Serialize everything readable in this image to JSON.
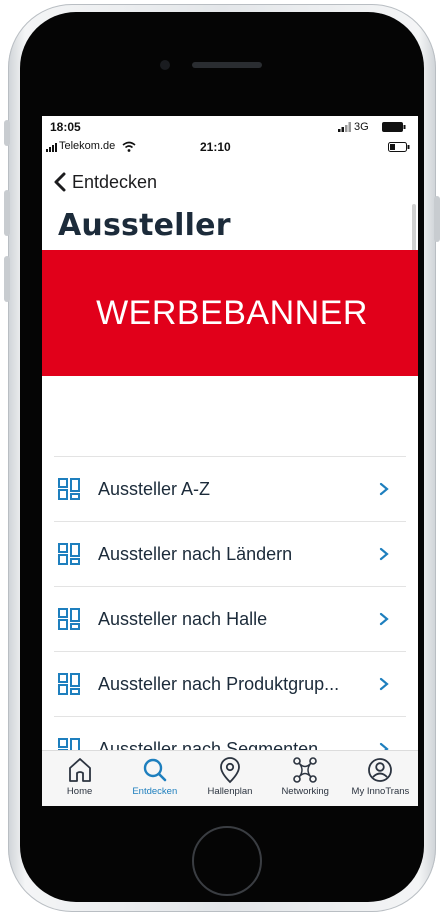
{
  "status": {
    "time_top": "18:05",
    "network_top": "3G",
    "carrier": "Telekom.de",
    "time_center": "21:10"
  },
  "nav": {
    "back_label": "Entdecken"
  },
  "page": {
    "title": "Aussteller"
  },
  "banner": {
    "text": "WERBEBANNER",
    "color": "#e1001a"
  },
  "list": {
    "items": [
      {
        "label": "Aussteller A-Z"
      },
      {
        "label": "Aussteller nach Ländern"
      },
      {
        "label": "Aussteller nach Halle"
      },
      {
        "label": "Aussteller nach Produktgrup..."
      },
      {
        "label": "Aussteller nach Segmenten"
      }
    ],
    "icon": "grid-icon",
    "accent": "#1e7fbe"
  },
  "tabbar": {
    "tabs": [
      {
        "label": "Home",
        "icon": "home-icon"
      },
      {
        "label": "Entdecken",
        "icon": "search-icon",
        "active": true
      },
      {
        "label": "Hallenplan",
        "icon": "location-pin-icon"
      },
      {
        "label": "Networking",
        "icon": "network-icon"
      },
      {
        "label": "My InnoTrans",
        "icon": "user-icon"
      }
    ]
  }
}
